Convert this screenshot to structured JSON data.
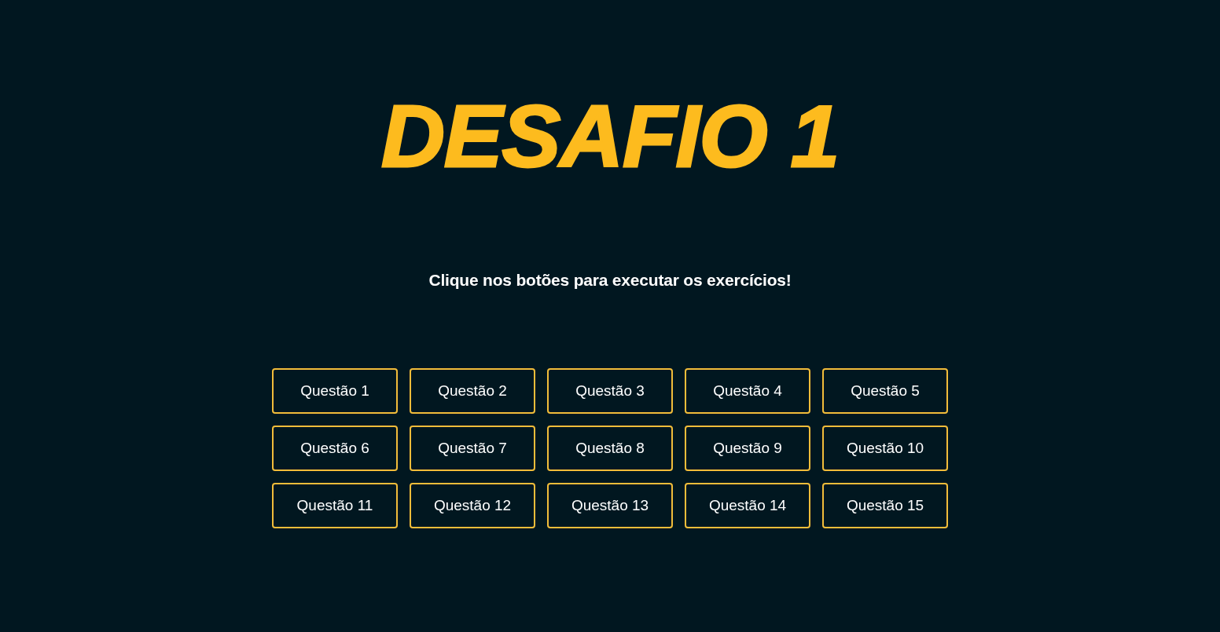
{
  "title": "DESAFIO 1",
  "subtitle": "Clique nos botões para executar os exercícios!",
  "buttons": [
    "Questão 1",
    "Questão 2",
    "Questão 3",
    "Questão 4",
    "Questão 5",
    "Questão 6",
    "Questão 7",
    "Questão 8",
    "Questão 9",
    "Questão 10",
    "Questão 11",
    "Questão 12",
    "Questão 13",
    "Questão 14",
    "Questão 15"
  ]
}
